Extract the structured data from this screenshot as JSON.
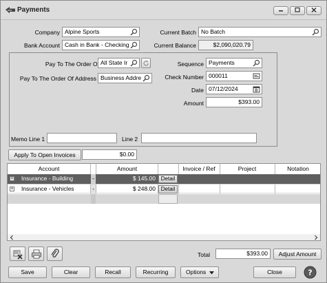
{
  "window": {
    "title": "Payments",
    "controls": [
      "minimize",
      "maximize",
      "close"
    ]
  },
  "header": {
    "company_label": "Company",
    "company_value": "Alpine Sports",
    "current_batch_label": "Current Batch",
    "current_batch_value": "No Batch",
    "bank_account_label": "Bank Account",
    "bank_account_value": "Cash in Bank - Checking",
    "current_balance_label": "Current Balance",
    "current_balance_value": "$2,090,020.79"
  },
  "payment": {
    "pay_to_label": "Pay To The Order Of",
    "pay_to_value": "All State Ir",
    "pay_to_address_label": "Pay To The Order Of Address",
    "pay_to_address_value": "Business Addre",
    "sequence_label": "Sequence",
    "sequence_value": "Payments",
    "check_number_label": "Check Number",
    "check_number_value": "000011",
    "date_label": "Date",
    "date_value": "07/12/2024",
    "amount_label": "Amount",
    "amount_value": "$393.00",
    "memo1_label": "Memo Line 1",
    "memo1_value": "",
    "memo2_label": "Line 2",
    "memo2_value": ""
  },
  "apply": {
    "button_label": "Apply To Open Invoices",
    "amount": "$0.00"
  },
  "grid": {
    "columns": [
      "Account",
      "Amount",
      "Invoice / Ref",
      "Project",
      "Notation"
    ],
    "rows": [
      {
        "account": "Insurance - Building",
        "amount": "$ 145.00",
        "detail": "Detail",
        "selected": true
      },
      {
        "account": "Insurance - Vehicles",
        "amount": "$ 248.00",
        "detail": "Detail",
        "selected": false
      }
    ]
  },
  "footer": {
    "total_label": "Total",
    "total_value": "$393.00",
    "adjust_amount_label": "Adjust Amount",
    "buttons": {
      "save": "Save",
      "clear": "Clear",
      "recall": "Recall",
      "recurring": "Recurring",
      "options": "Options",
      "close": "Close"
    }
  },
  "colors": {
    "window_bg": "#d9d9d9",
    "selected_row": "#5f5f5f"
  }
}
